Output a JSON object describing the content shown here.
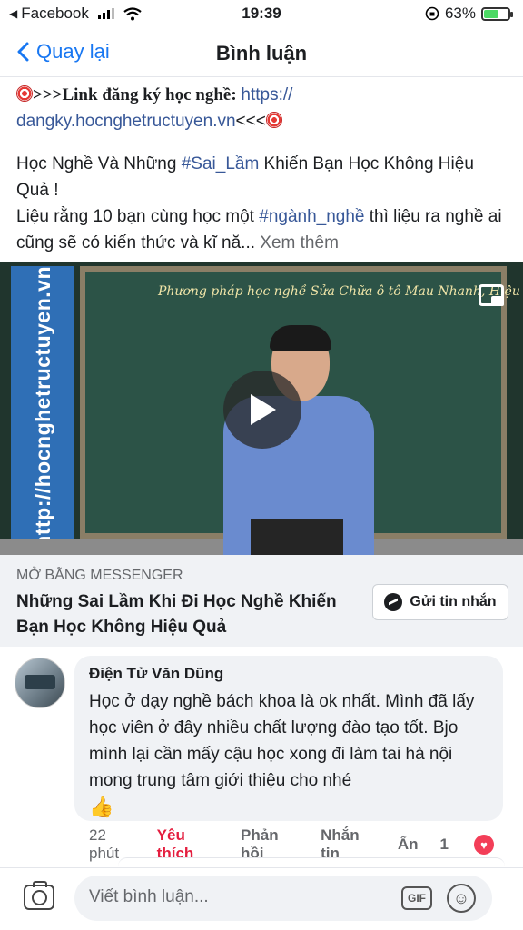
{
  "status_bar": {
    "carrier": "Facebook",
    "time": "19:39",
    "battery": "63%",
    "battery_level": 0.63
  },
  "nav": {
    "back_label": "Quay lại",
    "title": "Bình luận"
  },
  "post": {
    "link_prefix": ">>>Link đăng ký học nghề: ",
    "link_url_a": "https://",
    "link_url_b": "dangky.hocnghetructuyen.vn",
    "link_suffix": "<<<",
    "line1_a": "Học Nghề Và Những ",
    "hashtag1": "#Sai_Lầm",
    "line1_b": " Khiến Bạn Học Không Hiệu Quả !",
    "line2_a": "Liệu rằng 10 bạn cùng học một ",
    "hashtag2": "#ngành_nghề",
    "line2_b": " thì liệu ra nghề ai cũng sẽ có kiến thức và kĩ nă...",
    "see_more": " Xem thêm"
  },
  "video": {
    "banner_text": "http://hocnghetructuyen.vn",
    "board_text": "Phương pháp học nghề Sửa Chữa ô tô Mau Nhanh, Hiệu Quả"
  },
  "messenger_card": {
    "eyebrow": "MỞ BẰNG MESSENGER",
    "headline": "Những Sai Lầm Khi Đi Học Nghề Khiến Bạn Học Không Hiệu Quả",
    "button_label": "Gửi tin nhắn"
  },
  "comment": {
    "author": "Điện Tử Văn Dũng",
    "text": "Học ở dạy nghề bách khoa là ok nhất. Mình đã lấy học viên ở đây nhiều chất lượng đào tạo tốt. Bjo mình lại cần mấy cậu học xong đi làm tai hà nội mong trung tâm giới thiệu cho nhé",
    "emoji": "👍",
    "time": "22 phút",
    "like": "Yêu thích",
    "reply": "Phản hồi",
    "message": "Nhắn tin",
    "hide": "Ẩn",
    "reaction_count": "1"
  },
  "composer": {
    "placeholder": "Viết bình luận...",
    "gif_label": "GIF"
  },
  "colors": {
    "accent": "#1877f2",
    "link": "#385898",
    "like": "#e41e3f",
    "heart": "#f33e58"
  }
}
